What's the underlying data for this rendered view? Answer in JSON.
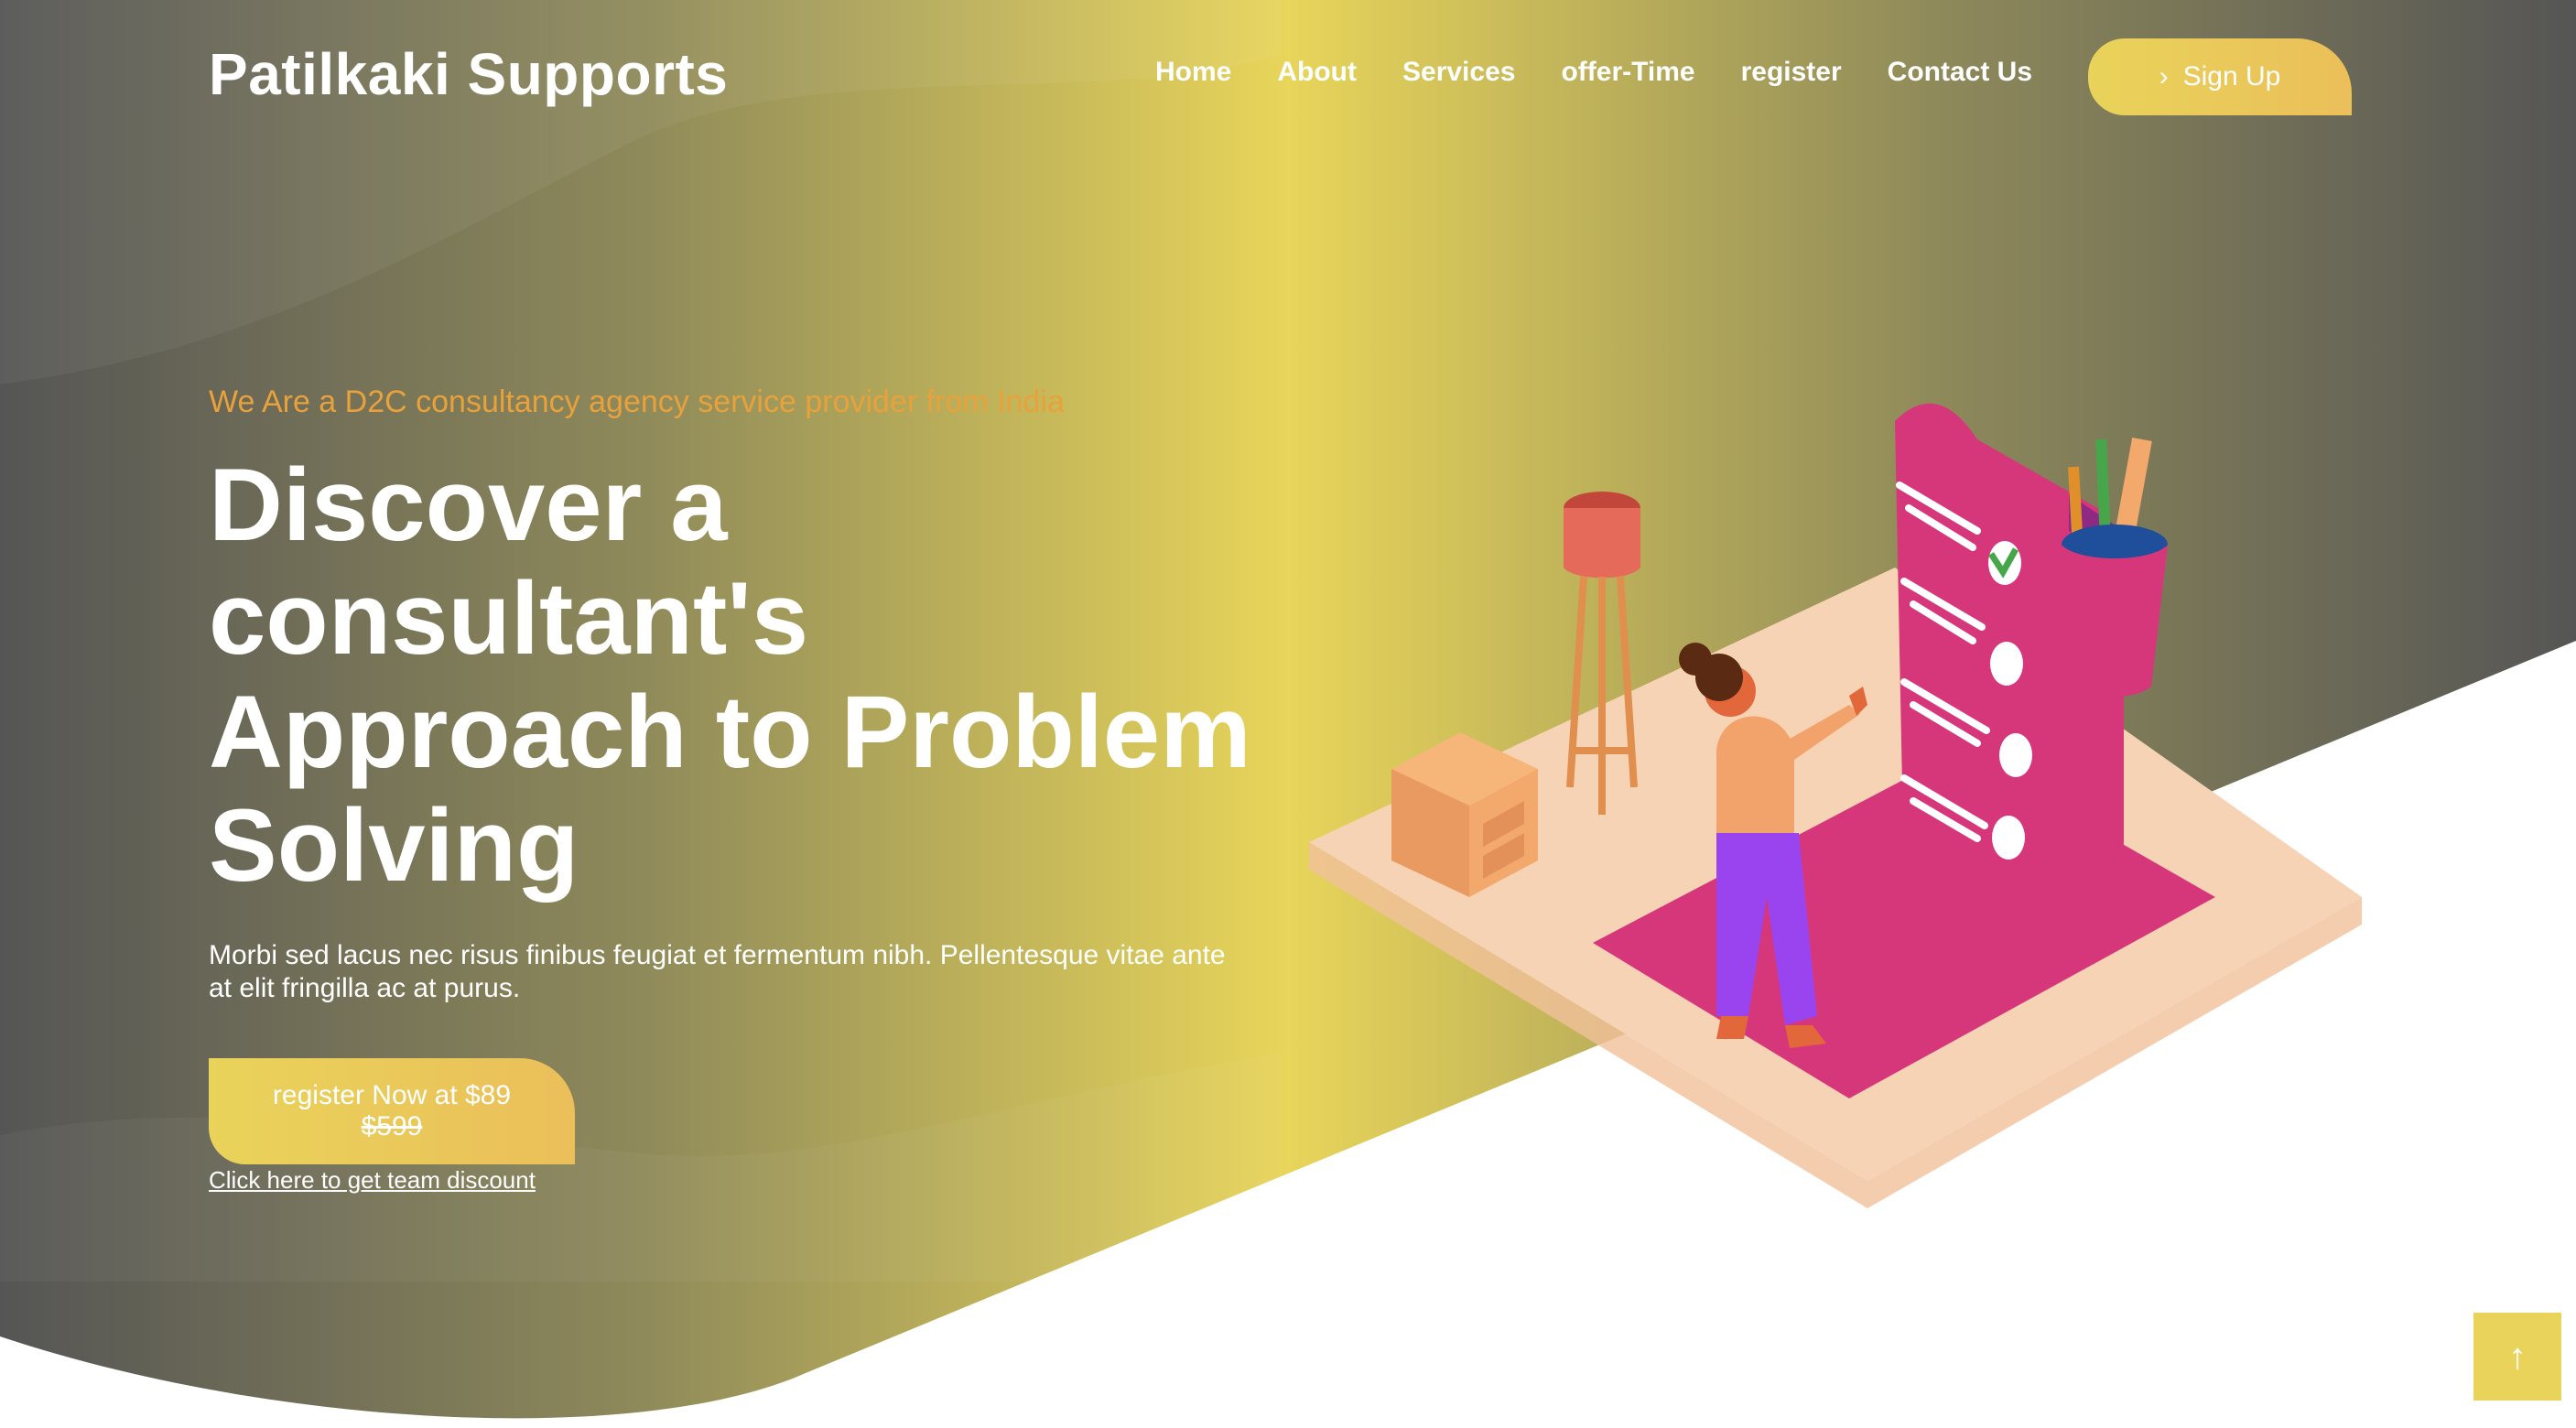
{
  "header": {
    "logo": "Patilkaki Supports",
    "nav": [
      {
        "label": "Home"
      },
      {
        "label": "About"
      },
      {
        "label": "Services"
      },
      {
        "label": "offer-Time"
      },
      {
        "label": "register"
      },
      {
        "label": "Contact Us"
      }
    ],
    "signup_label": "Sign Up",
    "signup_icon": "chevron-right-icon"
  },
  "hero": {
    "tagline": "We Are a D2C consultancy agency service provider from India",
    "headline": "Discover a consultant's Approach to Problem Solving",
    "description": "Morbi sed lacus nec risus finibus feugiat et fermentum nibh. Pellentesque vitae ante at elit fringilla ac at purus.",
    "cta_label": "register Now at $89",
    "cta_old_price": "$599",
    "discount_link": "Click here to get team discount"
  },
  "back_to_top_icon": "arrow-up-icon",
  "colors": {
    "accent": "#e9d35a",
    "accent_orange": "#ebbf5a",
    "tagline": "#e9a13b",
    "dark": "#555555",
    "magenta": "#d6377b",
    "purple": "#9a44f0"
  }
}
